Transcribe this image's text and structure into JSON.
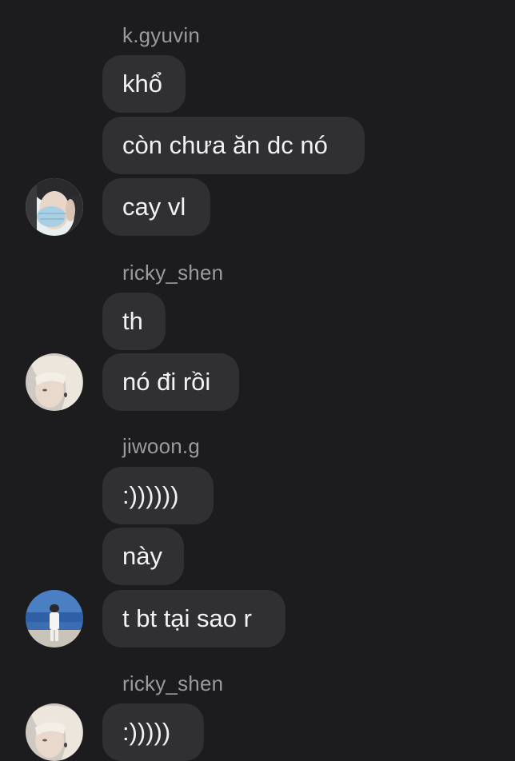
{
  "chat": {
    "groups": [
      {
        "sender": "k.gyuvin",
        "messages": [
          "khổ",
          "còn chưa ăn dc nó",
          "cay vl"
        ],
        "avatar_icon": "masked-person-avatar"
      },
      {
        "sender": "ricky_shen",
        "messages": [
          "th",
          "nó đi rồi"
        ],
        "avatar_icon": "blond-person-avatar"
      },
      {
        "sender": "jiwoon.g",
        "messages": [
          ":))))))",
          "này",
          "t bt tại sao r"
        ],
        "avatar_icon": "beach-person-avatar"
      },
      {
        "sender": "ricky_shen",
        "messages": [
          ":)))))"
        ],
        "avatar_icon": "blond-person-avatar"
      }
    ]
  },
  "colors": {
    "background": "#1c1c1e",
    "bubble": "#303033",
    "message_text": "#f2f2f4",
    "sender_text": "#9a9a9f"
  }
}
